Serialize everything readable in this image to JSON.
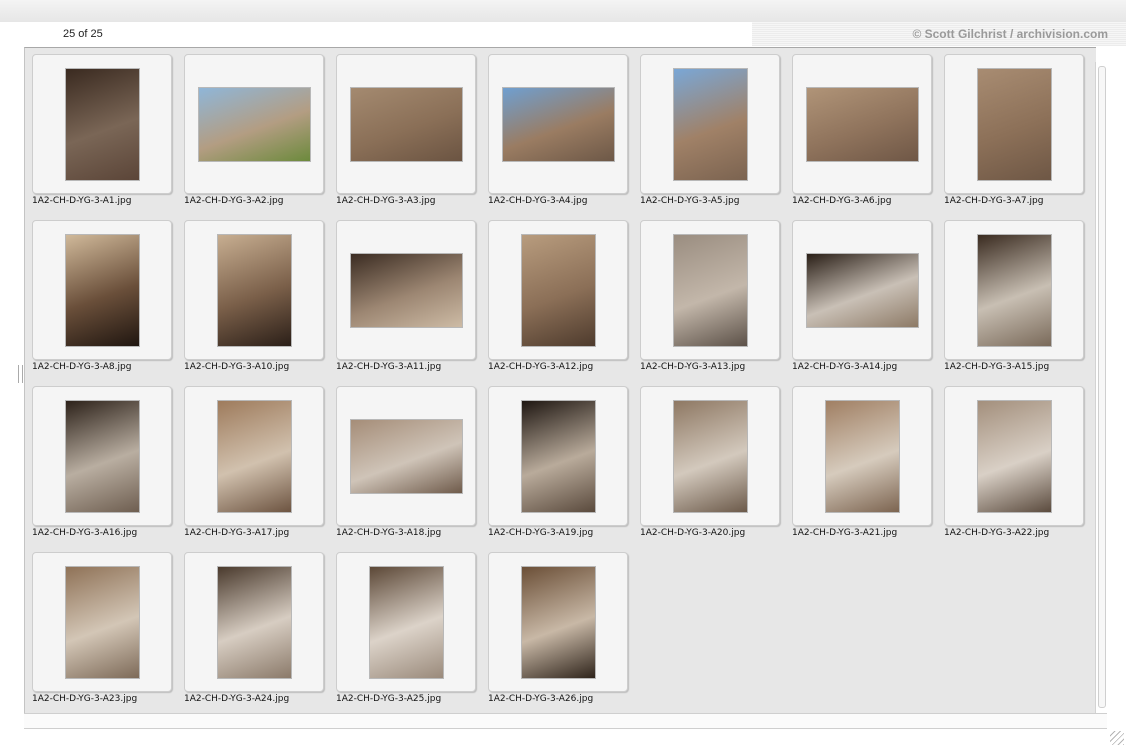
{
  "header": {
    "count": "25 of 25",
    "credit": "© Scott Gilchrist / archivision.com"
  },
  "thumbnails": [
    {
      "file": "1A2-CH-D-YG-3-A1.jpg",
      "orientation": "p",
      "colors": [
        "#3a2a20",
        "#7a6656",
        "#5b4538"
      ]
    },
    {
      "file": "1A2-CH-D-YG-3-A2.jpg",
      "orientation": "l",
      "colors": [
        "#8fb6d8",
        "#b39d82",
        "#6c8a3c"
      ]
    },
    {
      "file": "1A2-CH-D-YG-3-A3.jpg",
      "orientation": "l",
      "colors": [
        "#a48a70",
        "#8a6f57",
        "#6b5442"
      ]
    },
    {
      "file": "1A2-CH-D-YG-3-A4.jpg",
      "orientation": "l",
      "colors": [
        "#6f9fd0",
        "#9a7c62",
        "#6d5847"
      ]
    },
    {
      "file": "1A2-CH-D-YG-3-A5.jpg",
      "orientation": "p",
      "colors": [
        "#7aa7d6",
        "#a08167",
        "#7b6350"
      ]
    },
    {
      "file": "1A2-CH-D-YG-3-A6.jpg",
      "orientation": "l",
      "colors": [
        "#b09478",
        "#8f735c",
        "#6f5746"
      ]
    },
    {
      "file": "1A2-CH-D-YG-3-A7.jpg",
      "orientation": "p",
      "colors": [
        "#a88c72",
        "#8c7058",
        "#6e5745"
      ]
    },
    {
      "file": "1A2-CH-D-YG-3-A8.jpg",
      "orientation": "p",
      "colors": [
        "#d0b99a",
        "#6a4f3a",
        "#201610"
      ]
    },
    {
      "file": "1A2-CH-D-YG-3-A10.jpg",
      "orientation": "p",
      "colors": [
        "#c7ae91",
        "#7a5f49",
        "#2b1f18"
      ]
    },
    {
      "file": "1A2-CH-D-YG-3-A11.jpg",
      "orientation": "l",
      "colors": [
        "#3b2c22",
        "#9c8672",
        "#cdbba5"
      ]
    },
    {
      "file": "1A2-CH-D-YG-3-A12.jpg",
      "orientation": "p",
      "colors": [
        "#b89c7e",
        "#8b6f57",
        "#4e3b2d"
      ]
    },
    {
      "file": "1A2-CH-D-YG-3-A13.jpg",
      "orientation": "p",
      "colors": [
        "#9a8d80",
        "#c3b7aa",
        "#5c5148"
      ]
    },
    {
      "file": "1A2-CH-D-YG-3-A14.jpg",
      "orientation": "l",
      "colors": [
        "#2a1f17",
        "#c9c0b6",
        "#8d7a66"
      ]
    },
    {
      "file": "1A2-CH-D-YG-3-A15.jpg",
      "orientation": "p",
      "colors": [
        "#3a2b20",
        "#c8bfb3",
        "#7a6a5a"
      ]
    },
    {
      "file": "1A2-CH-D-YG-3-A16.jpg",
      "orientation": "p",
      "colors": [
        "#2d221a",
        "#b9aea1",
        "#6e5e50"
      ]
    },
    {
      "file": "1A2-CH-D-YG-3-A17.jpg",
      "orientation": "p",
      "colors": [
        "#9e7b5c",
        "#d1c1ae",
        "#6d5441"
      ]
    },
    {
      "file": "1A2-CH-D-YG-3-A18.jpg",
      "orientation": "l",
      "colors": [
        "#a58d78",
        "#cfc4b8",
        "#6f5b4b"
      ]
    },
    {
      "file": "1A2-CH-D-YG-3-A19.jpg",
      "orientation": "p",
      "colors": [
        "#1f1712",
        "#b9ab9b",
        "#5a4a3d"
      ]
    },
    {
      "file": "1A2-CH-D-YG-3-A20.jpg",
      "orientation": "p",
      "colors": [
        "#8e7863",
        "#d3c9bd",
        "#6c5a4a"
      ]
    },
    {
      "file": "1A2-CH-D-YG-3-A21.jpg",
      "orientation": "p",
      "colors": [
        "#a07f63",
        "#d6cbbd",
        "#7c6450"
      ]
    },
    {
      "file": "1A2-CH-D-YG-3-A22.jpg",
      "orientation": "p",
      "colors": [
        "#a38f7c",
        "#d9d0c6",
        "#5b4b3e"
      ]
    },
    {
      "file": "1A2-CH-D-YG-3-A23.jpg",
      "orientation": "p",
      "colors": [
        "#8f7257",
        "#d3c6b6",
        "#7d6a58"
      ]
    },
    {
      "file": "1A2-CH-D-YG-3-A24.jpg",
      "orientation": "p",
      "colors": [
        "#4a3a2d",
        "#d7cdc2",
        "#8b7a6a"
      ]
    },
    {
      "file": "1A2-CH-D-YG-3-A25.jpg",
      "orientation": "p",
      "colors": [
        "#5c4837",
        "#dcd3c9",
        "#9a8a7b"
      ]
    },
    {
      "file": "1A2-CH-D-YG-3-A26.jpg",
      "orientation": "p",
      "colors": [
        "#6b4f37",
        "#c8b8a6",
        "#2f241b"
      ]
    }
  ]
}
